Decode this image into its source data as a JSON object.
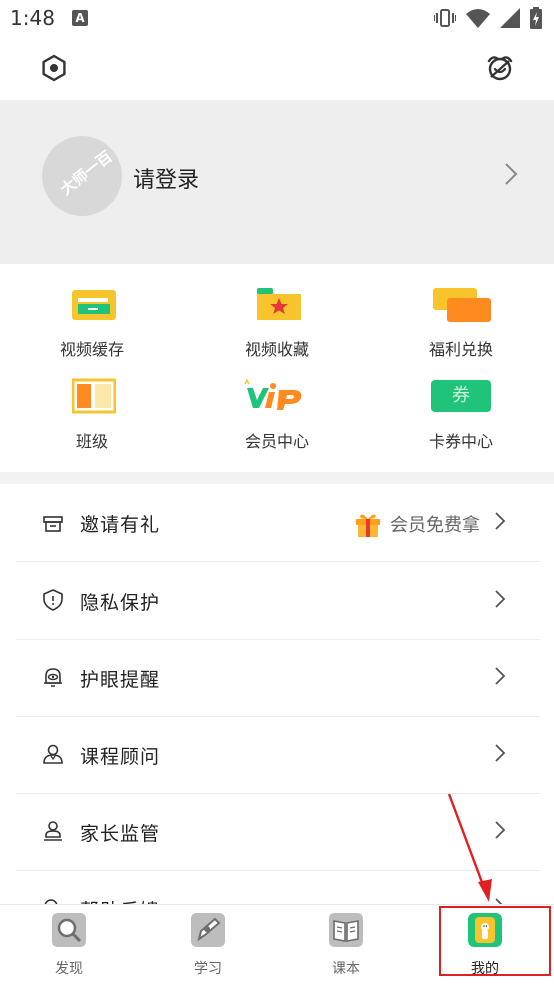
{
  "status": {
    "time": "1:48",
    "badge": "A"
  },
  "profile": {
    "login_label": "请登录",
    "avatar_watermark": "大师一百"
  },
  "grid": {
    "items": [
      {
        "label": "视频缓存",
        "icon": "video-cache-icon"
      },
      {
        "label": "视频收藏",
        "icon": "video-favorite-icon"
      },
      {
        "label": "福利兑换",
        "icon": "benefit-exchange-icon"
      },
      {
        "label": "班级",
        "icon": "class-icon"
      },
      {
        "label": "会员中心",
        "icon": "vip-icon"
      },
      {
        "label": "卡券中心",
        "icon": "coupon-icon"
      }
    ],
    "coupon_glyph": "券"
  },
  "menu": {
    "items": [
      {
        "label": "邀请有礼",
        "extra": "会员免费拿",
        "icon": "gift-box-icon"
      },
      {
        "label": "隐私保护",
        "icon": "shield-icon"
      },
      {
        "label": "护眼提醒",
        "icon": "eye-bell-icon"
      },
      {
        "label": "课程顾问",
        "icon": "advisor-icon"
      },
      {
        "label": "家长监管",
        "icon": "parent-icon"
      },
      {
        "label": "帮助反馈",
        "icon": "help-icon"
      }
    ]
  },
  "tabs": [
    {
      "label": "发现",
      "icon": "discover-icon"
    },
    {
      "label": "学习",
      "icon": "study-icon"
    },
    {
      "label": "课本",
      "icon": "textbook-icon"
    },
    {
      "label": "我的",
      "icon": "profile-icon",
      "active": true
    }
  ],
  "colors": {
    "accent_green": "#1fc37a",
    "yellow": "#f7c52b",
    "highlight_red": "#e02020"
  }
}
